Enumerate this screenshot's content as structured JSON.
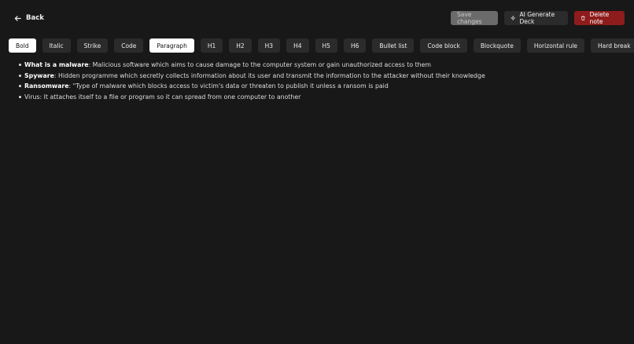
{
  "topbar": {
    "back_label": "Back",
    "save_label": "Save changes",
    "ai_label": "AI Generate Deck",
    "delete_label": "Delete note"
  },
  "toolbar": {
    "items": [
      "Bold",
      "Italic",
      "Strike",
      "Code",
      "Paragraph",
      "H1",
      "H2",
      "H3",
      "H4",
      "H5",
      "H6",
      "Bullet list",
      "Code block",
      "Blockquote",
      "Horizontal rule",
      "Hard break"
    ],
    "active": [
      "Bold",
      "Paragraph"
    ]
  },
  "editor": {
    "items": [
      {
        "term": "What is a malware",
        "text": ": Malicious software which aims to cause damage to the computer system or gain unauthorized access to them"
      },
      {
        "term": "Spyware",
        "text": ": Hidden programme which secretly collects information about its user and transmit the information to the attacker without their knowledge"
      },
      {
        "term": "Ransomware",
        "text": ": \"Type of malware which blocks access to victim's data or threaten to publish it unless a ransom is paid"
      },
      {
        "term": "",
        "text": "Virus: It attaches itself to a file or program so it can spread from one computer to another"
      }
    ]
  },
  "colors": {
    "background": "#181818",
    "button": "#2b2b2b",
    "delete": "#8e1c1c",
    "save_disabled": "#6b6b6b"
  },
  "icons": {
    "back": "arrow-left-icon",
    "ai": "sparkle-icon",
    "delete": "trash-icon"
  }
}
